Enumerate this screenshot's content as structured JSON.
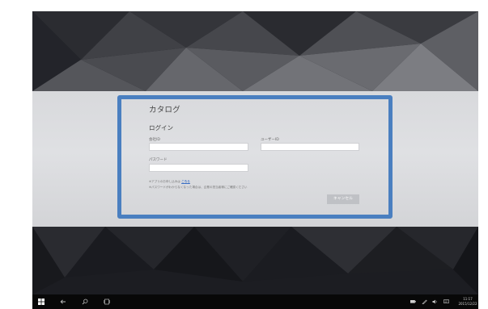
{
  "app": {
    "title": "カタログ"
  },
  "login": {
    "heading": "ログイン",
    "company_id_label": "会社ID",
    "user_id_label": "ユーザーID",
    "password_label": "パスワード",
    "company_id_value": "",
    "user_id_value": "",
    "password_value": "",
    "info_line_1_prefix": "※アプリのお申し込みは",
    "info_link": "こちら",
    "info_line_2": "※パスワードがわからなくなった場合は、企業の担当者様にご確認ください",
    "cancel_label": "キャンセル"
  },
  "taskbar": {
    "icons": [
      "windows-start-icon",
      "back-arrow-icon",
      "search-icon",
      "task-view-icon"
    ],
    "tray_icons": [
      "battery-icon",
      "pen-icon",
      "volume-icon",
      "notification-icon"
    ],
    "time": "11:17",
    "date": "2015/12/22"
  },
  "colors": {
    "highlight_border": "#4a7fc0",
    "band": "#dcdddf",
    "taskbar": "#080808",
    "link": "#3a6fc4"
  }
}
